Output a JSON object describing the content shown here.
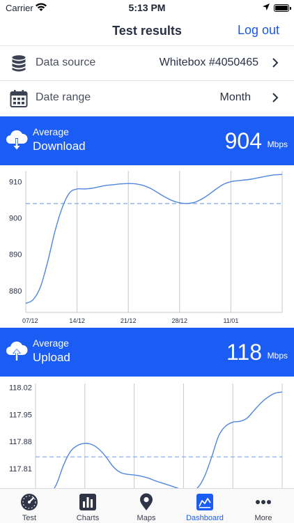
{
  "status_bar": {
    "carrier": "Carrier",
    "time": "5:13 PM"
  },
  "nav": {
    "title": "Test results",
    "action": "Log out"
  },
  "settings": [
    {
      "label": "Data source",
      "value": "Whitebox #4050465",
      "icon": "database-icon"
    },
    {
      "label": "Date range",
      "value": "Month",
      "icon": "calendar-icon"
    }
  ],
  "download": {
    "label": "Average",
    "metric": "Download",
    "value": "904",
    "unit": "Mbps",
    "icon": "cloud-download-icon"
  },
  "upload": {
    "label": "Average",
    "metric": "Upload",
    "value": "118",
    "unit": "Mbps",
    "icon": "cloud-upload-icon"
  },
  "chart_data": [
    {
      "type": "line",
      "title": "",
      "xlabel": "",
      "ylabel": "",
      "x_ticks": [
        "07/12",
        "14/12",
        "21/12",
        "28/12",
        "11/01"
      ],
      "y_ticks": [
        880,
        890,
        900,
        910
      ],
      "ylim": [
        874,
        913
      ],
      "xlim": [
        0,
        35
      ],
      "average": 904,
      "series": [
        {
          "x": [
            0,
            1,
            2,
            3,
            4,
            5,
            6,
            7,
            8,
            9,
            10,
            11,
            12,
            13,
            14,
            15,
            16,
            17,
            18,
            19,
            20,
            21,
            22,
            23,
            24,
            25,
            26,
            27,
            28,
            29,
            30,
            31,
            32,
            33,
            34,
            35
          ],
          "y": [
            876.5,
            877.5,
            881,
            888,
            896.5,
            903,
            907,
            908,
            908,
            908.2,
            908.6,
            909,
            909.2,
            909.4,
            909.5,
            909.4,
            909,
            908.2,
            907,
            905.8,
            904.8,
            904.2,
            904,
            904.3,
            905.2,
            906.5,
            908,
            909.3,
            910,
            910.3,
            910.5,
            910.8,
            911.2,
            911.6,
            911.9,
            912
          ]
        }
      ],
      "grid": "vertical",
      "colors": {
        "line": "#4f86df",
        "average": "#7ea6e6",
        "grid": "#c8c8c8"
      }
    },
    {
      "type": "line",
      "title": "",
      "xlabel": "",
      "ylabel": "",
      "y_ticks": [
        117.81,
        117.88,
        117.95,
        118.02
      ],
      "ylim": [
        117.75,
        118.03
      ],
      "xlim": [
        0,
        35
      ],
      "average": 117.84,
      "series": [
        {
          "x": [
            2,
            3,
            4,
            5,
            6,
            7,
            8,
            9,
            10,
            11,
            12,
            13,
            14,
            15,
            16,
            17,
            18,
            19,
            20,
            21,
            22,
            23,
            24,
            25,
            26,
            27,
            28,
            29,
            30,
            31,
            32,
            33,
            34,
            35
          ],
          "y": [
            117.74,
            117.77,
            117.82,
            117.855,
            117.87,
            117.875,
            117.872,
            117.86,
            117.84,
            117.815,
            117.8,
            117.795,
            117.793,
            117.79,
            117.785,
            117.778,
            117.772,
            117.766,
            117.76,
            117.755,
            117.754,
            117.76,
            117.79,
            117.84,
            117.895,
            117.92,
            117.93,
            117.932,
            117.94,
            117.96,
            117.98,
            117.995,
            118.005,
            118.008
          ]
        }
      ],
      "grid": "vertical",
      "colors": {
        "line": "#4f86df",
        "average": "#7ea6e6",
        "grid": "#c8c8c8"
      }
    }
  ],
  "tabs": [
    {
      "label": "Test",
      "icon": "speedometer-icon",
      "active": false
    },
    {
      "label": "Charts",
      "icon": "bar-chart-icon",
      "active": false
    },
    {
      "label": "Maps",
      "icon": "map-pin-icon",
      "active": false
    },
    {
      "label": "Dashboard",
      "icon": "dashboard-icon",
      "active": true
    },
    {
      "label": "More",
      "icon": "more-dots-icon",
      "active": false
    }
  ],
  "colors": {
    "accent": "#1b5cf5",
    "link": "#1a56e8"
  }
}
